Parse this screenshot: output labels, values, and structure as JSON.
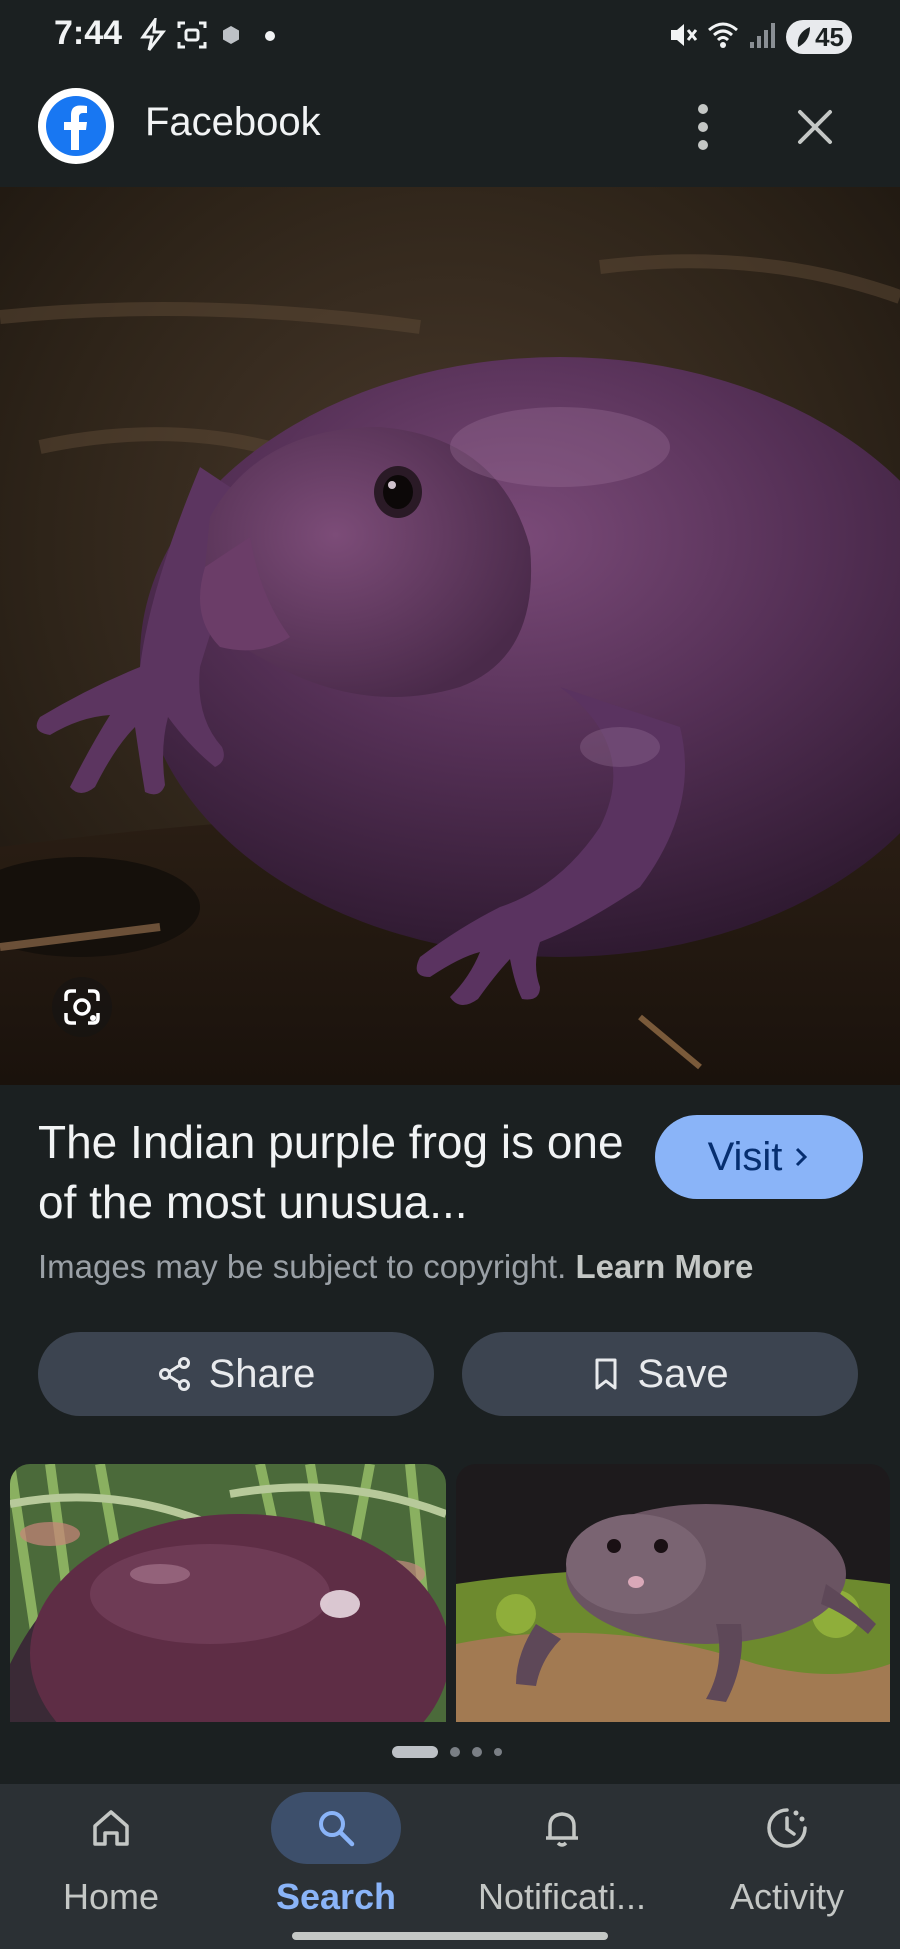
{
  "status_bar": {
    "time": "7:44",
    "battery": "45"
  },
  "header": {
    "title": "Facebook"
  },
  "result": {
    "caption": "The Indian purple frog is one of the most unusua...",
    "visit_label": "Visit",
    "copyright_text": "Images may be subject to copyright.",
    "learn_more": "Learn More"
  },
  "actions": {
    "share_label": "Share",
    "save_label": "Save"
  },
  "carousel": {
    "page_count": 4,
    "active_index": 0
  },
  "bottom_nav": {
    "items": [
      {
        "label": "Home",
        "icon": "home-icon"
      },
      {
        "label": "Search",
        "icon": "search-icon",
        "active": true
      },
      {
        "label": "Notificati...",
        "icon": "bell-icon"
      },
      {
        "label": "Activity",
        "icon": "activity-icon"
      }
    ]
  },
  "colors": {
    "background": "#1b2021",
    "accent": "#8ab4f8",
    "button_bg": "#3c4450",
    "nav_bg": "#2b3034"
  }
}
